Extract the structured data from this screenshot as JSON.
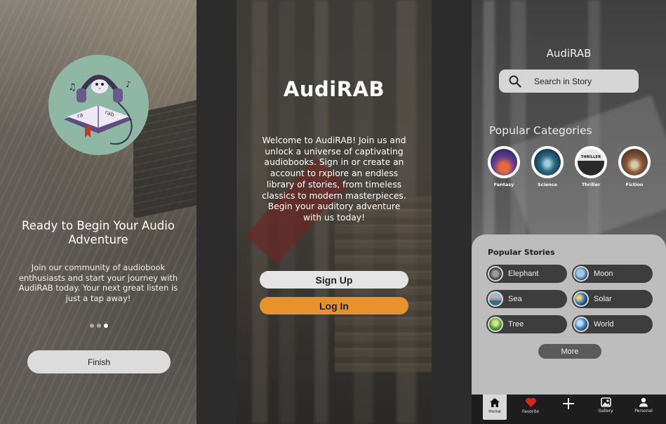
{
  "onboarding": {
    "title": "Ready to Begin Your Audio Adventure",
    "text": "Join our community of audiobook enthusiasts and start your journey with AudiRAB today. Your next great listen is just a tap away!",
    "pages_total": 3,
    "page_current": 3,
    "finish_label": "Finish"
  },
  "welcome": {
    "brand": "AudiRAB",
    "message": "Welcome to AudiRAB! Join us and unlock a universe of captivating audiobooks. Sign in or create an account to rxplore an endless library of stories, from timeless classics to modern masterpieces. Begin your auditory adventure with us today!",
    "signup_label": "Sign Up",
    "login_label": "Log In",
    "login_color": "#e8922d"
  },
  "home": {
    "title": "AudiRAB",
    "search_placeholder": "Search in Story",
    "categories_heading": "Popular Categories",
    "categories": [
      {
        "label": "Fantasy",
        "icon": "fantasy-image"
      },
      {
        "label": "Science",
        "icon": "science-image"
      },
      {
        "label": "Thriller",
        "icon": "thriller-image"
      },
      {
        "label": "Fiction",
        "icon": "fiction-image"
      }
    ],
    "stories_heading": "Popular Stories",
    "stories": [
      {
        "name": "Elephant"
      },
      {
        "name": "Moon"
      },
      {
        "name": "Sea"
      },
      {
        "name": "Solar"
      },
      {
        "name": "Tree"
      },
      {
        "name": "World"
      }
    ],
    "more_label": "More",
    "tabs": [
      {
        "label": "Home",
        "icon": "home-icon",
        "active": true
      },
      {
        "label": "Favorite",
        "icon": "heart-icon"
      },
      {
        "label": "",
        "icon": "plus-icon"
      },
      {
        "label": "Gallery",
        "icon": "gallery-icon"
      },
      {
        "label": "Personal",
        "icon": "person-icon"
      }
    ]
  }
}
